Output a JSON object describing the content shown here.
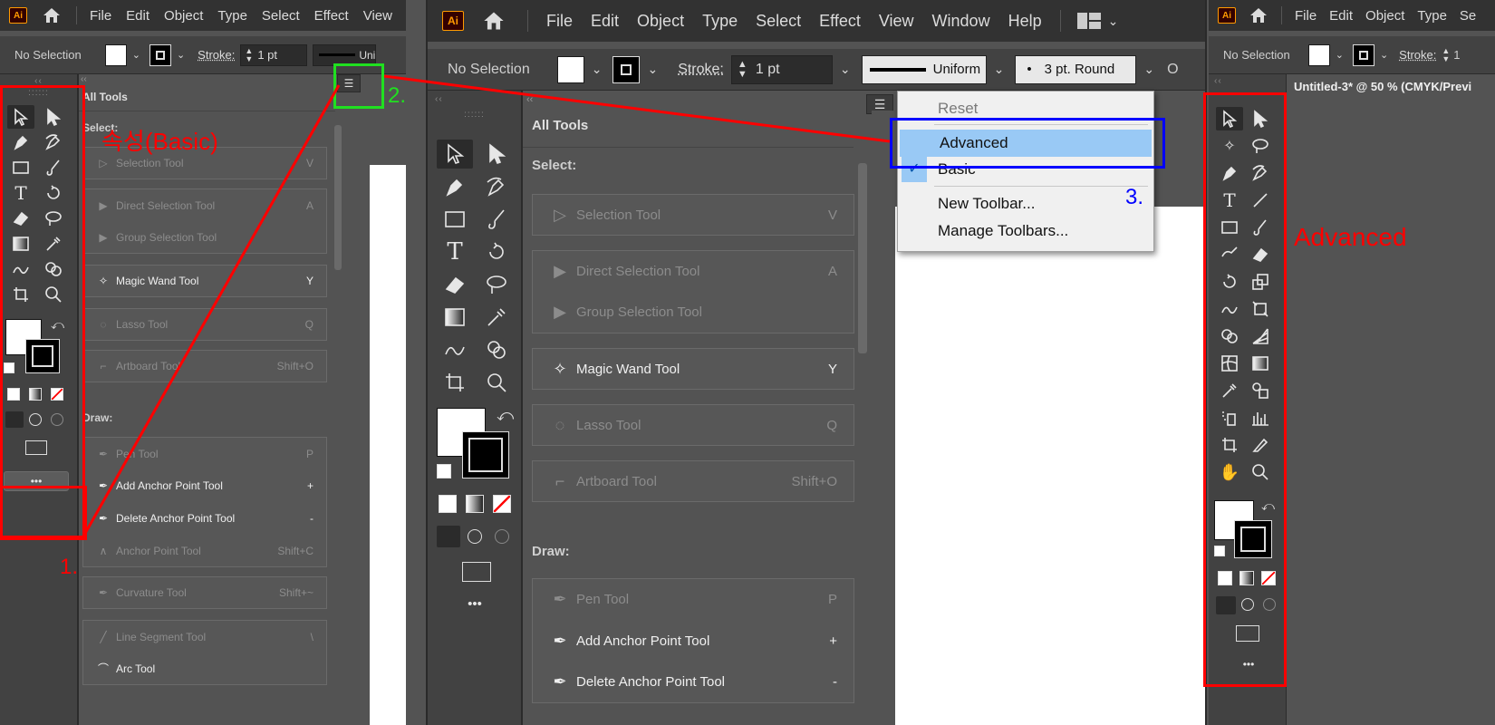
{
  "app": {
    "logo": "Ai"
  },
  "menu": [
    "File",
    "Edit",
    "Object",
    "Type",
    "Select",
    "Effect",
    "View",
    "Window",
    "Help"
  ],
  "left": {
    "menu_visible": [
      "File",
      "Edit",
      "Object",
      "Type",
      "Select",
      "Effect",
      "View"
    ]
  },
  "right": {
    "menu_visible": [
      "File",
      "Edit",
      "Object",
      "Type",
      "Se"
    ],
    "doc_title": "Untitled-3* @ 50 % (CMYK/Previ"
  },
  "control": {
    "selection": "No Selection",
    "stroke_label": "Stroke:",
    "stroke_value": "1 pt",
    "profile": "Uniform",
    "profile_short": "Uni",
    "brush": "3 pt. Round",
    "opacity_cut": "O",
    "stroke_cut": "1"
  },
  "panel": {
    "title": "All Tools",
    "sections": {
      "select": "Select:",
      "draw": "Draw:"
    },
    "tools": [
      {
        "name": "Selection Tool",
        "shortcut": "V"
      },
      {
        "name": "Direct Selection Tool",
        "shortcut": "A"
      },
      {
        "name": "Group Selection Tool",
        "shortcut": ""
      },
      {
        "name": "Magic Wand Tool",
        "shortcut": "Y"
      },
      {
        "name": "Lasso Tool",
        "shortcut": "Q"
      },
      {
        "name": "Artboard Tool",
        "shortcut": "Shift+O"
      },
      {
        "name": "Pen Tool",
        "shortcut": "P"
      },
      {
        "name": "Add Anchor Point Tool",
        "shortcut": "+"
      },
      {
        "name": "Delete Anchor Point Tool",
        "shortcut": "-"
      },
      {
        "name": "Anchor Point Tool",
        "shortcut": "Shift+C"
      },
      {
        "name": "Curvature Tool",
        "shortcut": "Shift+~"
      },
      {
        "name": "Line Segment Tool",
        "shortcut": "\\"
      },
      {
        "name": "Arc Tool",
        "shortcut": ""
      }
    ]
  },
  "dropdown": {
    "items": [
      "Reset",
      "Advanced",
      "Basic",
      "New Toolbar...",
      "Manage Toolbars..."
    ]
  },
  "more_label": "•••",
  "annotations": {
    "basic": "속성(Basic)",
    "advanced": "Advanced",
    "step1": "1.",
    "step2": "2.",
    "step3": "3."
  },
  "colors": {
    "annotation_red": "#ff0000",
    "annotation_green": "#20e020",
    "annotation_blue": "#0000ff",
    "menu_highlight": "#99c9f5"
  }
}
